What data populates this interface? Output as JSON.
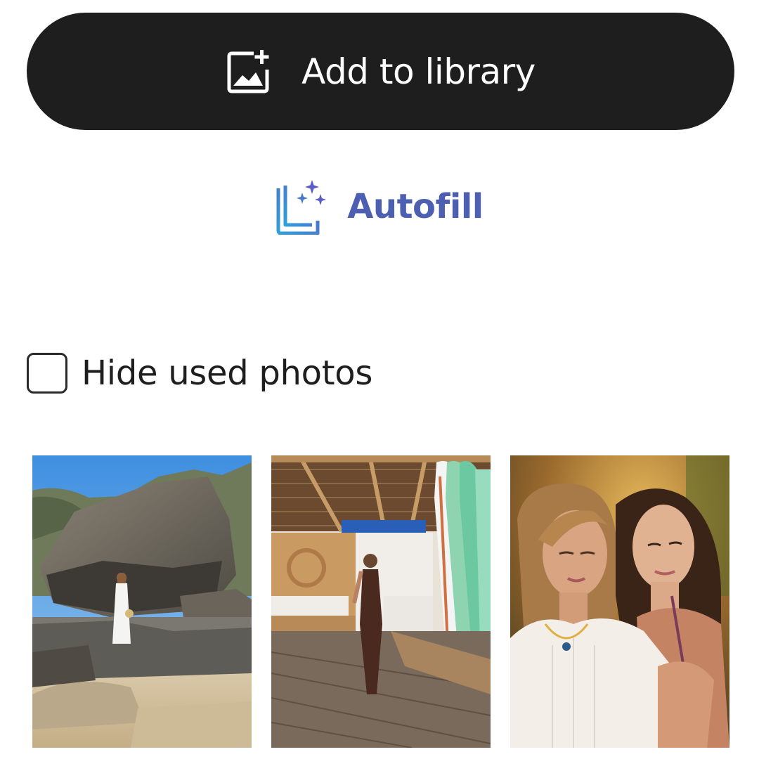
{
  "actions": {
    "add_to_library_label": "Add to library",
    "autofill_label": "Autofill"
  },
  "filters": {
    "hide_used_photos_label": "Hide used photos",
    "hide_used_photos_checked": false
  },
  "photos": [
    {
      "icon": "photo-rocky-beach-woman-white-dress"
    },
    {
      "icon": "photo-surf-shack-boards"
    },
    {
      "icon": "photo-two-women-portrait"
    }
  ],
  "colors": {
    "primary_button_bg": "#1e1e1e",
    "autofill_text": "#4d5fb0",
    "autofill_icon": "#3b8fd0"
  }
}
